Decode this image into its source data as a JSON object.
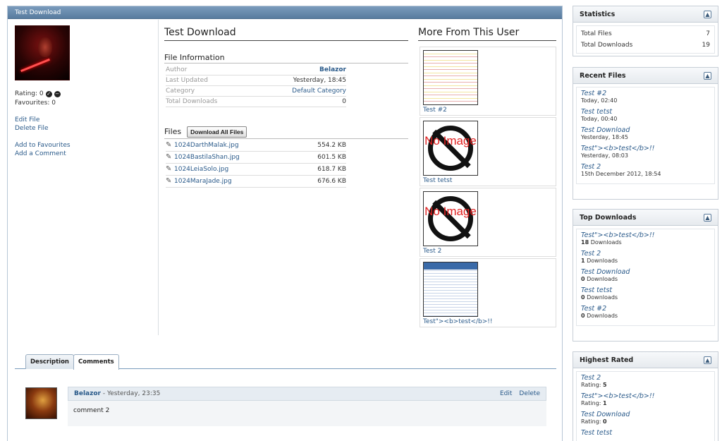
{
  "main": {
    "header_title": "Test Download",
    "file_title": "Test Download",
    "rating_label": "Rating: 0",
    "favourites_label": "Favourites: 0",
    "links": {
      "edit_file": "Edit File",
      "delete_file": "Delete File",
      "add_favourites": "Add to Favourites",
      "add_comment": "Add a Comment"
    },
    "file_info": {
      "heading": "File Information",
      "rows": [
        {
          "label": "Author",
          "value": "Belazor"
        },
        {
          "label": "Last Updated",
          "value": "Yesterday, 18:45"
        },
        {
          "label": "Category",
          "value": "Default Category"
        },
        {
          "label": "Total Downloads",
          "value": "0"
        }
      ]
    },
    "files": {
      "heading": "Files",
      "download_all_label": "Download All Files",
      "items": [
        {
          "name": "1024DarthMalak.jpg",
          "size": "554.2 KB"
        },
        {
          "name": "1024BastilaShan.jpg",
          "size": "601.5 KB"
        },
        {
          "name": "1024LeiaSolo.jpg",
          "size": "618.7 KB"
        },
        {
          "name": "1024MaraJade.jpg",
          "size": "676.6 KB"
        }
      ]
    },
    "more_from_user": {
      "heading": "More From This User",
      "no_image_text": "No Image",
      "items": [
        {
          "caption": "Test #2",
          "thumb": "spreadsheet-thumbnail"
        },
        {
          "caption": "Test tetst",
          "thumb": "no-image"
        },
        {
          "caption": "Test 2",
          "thumb": "no-image"
        },
        {
          "caption": "Test\"><b>test</b>!!",
          "thumb": "webpage-thumbnail"
        }
      ]
    },
    "tabs": [
      {
        "label": "Description",
        "active": false
      },
      {
        "label": "Comments",
        "active": true
      }
    ],
    "comment": {
      "author": "Belazor",
      "date": " - Yesterday, 23:35",
      "edit_label": "Edit",
      "delete_label": "Delete",
      "body": "comment 2"
    }
  },
  "sidebar": {
    "statistics": {
      "title": "Statistics",
      "rows": [
        {
          "label": "Total Files",
          "value": "7"
        },
        {
          "label": "Total Downloads",
          "value": "19"
        }
      ]
    },
    "recent_files": {
      "title": "Recent Files",
      "items": [
        {
          "title": "Test #2",
          "date": "Today, 02:40"
        },
        {
          "title": "Test tetst",
          "date": "Today, 00:40"
        },
        {
          "title": "Test Download",
          "date": "Yesterday, 18:45"
        },
        {
          "title": "Test\"><b>test</b>!!",
          "date": "Yesterday, 08:03"
        },
        {
          "title": "Test 2",
          "date": "15th December 2012, 18:54"
        }
      ]
    },
    "top_downloads": {
      "title": "Top Downloads",
      "suffix": "Downloads",
      "items": [
        {
          "title": "Test\"><b>test</b>!!",
          "count": "18"
        },
        {
          "title": "Test 2",
          "count": "1"
        },
        {
          "title": "Test Download",
          "count": "0"
        },
        {
          "title": "Test tetst",
          "count": "0"
        },
        {
          "title": "Test #2",
          "count": "0"
        }
      ]
    },
    "highest_rated": {
      "title": "Highest Rated",
      "prefix": "Rating:",
      "items": [
        {
          "title": "Test 2",
          "rating": "5"
        },
        {
          "title": "Test\"><b>test</b>!!",
          "rating": "1"
        },
        {
          "title": "Test Download",
          "rating": "0"
        },
        {
          "title": "Test tetst",
          "rating": ""
        }
      ]
    }
  },
  "icons": {
    "check": "check-circle-icon",
    "minus": "minus-circle-icon",
    "collapse": "collapse-up-icon",
    "attachment": "paperclip-icon"
  }
}
